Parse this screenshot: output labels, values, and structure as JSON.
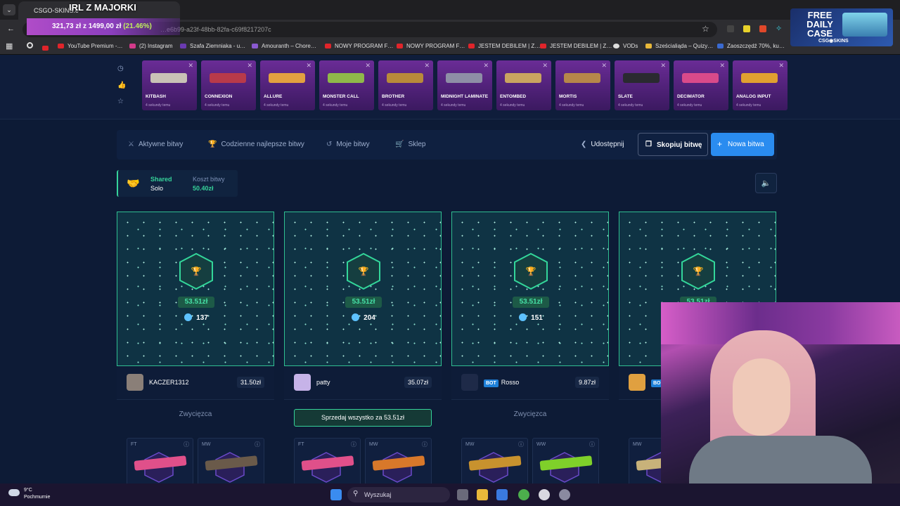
{
  "browser": {
    "tab_title": "CSGO-SKINS.c",
    "url": "…e6b99-a23f-48bb-82fa-c69f8217207c",
    "bookmarks": [
      {
        "label": "YouTube Premium -…"
      },
      {
        "label": "(2) Instagram"
      },
      {
        "label": "Szafa Ziemniaka - u…"
      },
      {
        "label": "Amouranth – Chore…"
      },
      {
        "label": "NOWY PROGRAM F…"
      },
      {
        "label": "NOWY PROGRAM F…"
      },
      {
        "label": "JESTEM DEBILEM | Z…"
      },
      {
        "label": "JESTEM DEBILEM | Z…"
      },
      {
        "label": "VODs"
      },
      {
        "label": "Sześcialiąda – Quizy…"
      },
      {
        "label": "Zaoszczędź 70%, ku…"
      }
    ]
  },
  "stream_overlay": {
    "title": "IRL Z MAJORKI",
    "goal_current": "321,73 zł",
    "goal_sep": "z",
    "goal_total": "1499,00 zł",
    "goal_pct": "(21.46%)",
    "promo_title": "FREE DAILY CASE",
    "promo_brand": "CSG◉SKINS"
  },
  "recent_drops": [
    {
      "name": "KITBASH",
      "time": "4 sekundy temu",
      "color": "#c9c2b6"
    },
    {
      "name": "CONNEXION",
      "time": "4 sekundy temu",
      "color": "#b83a4a"
    },
    {
      "name": "ALLURE",
      "time": "4 sekundy temu",
      "color": "#e2a040"
    },
    {
      "name": "MONSTER CALL",
      "time": "4 sekundy temu",
      "color": "#8fb84a"
    },
    {
      "name": "BROTHER",
      "time": "4 sekundy temu",
      "color": "#b88a3a"
    },
    {
      "name": "MIDNIGHT LAMINATE",
      "time": "4 sekundy temu",
      "color": "#8e8ea6"
    },
    {
      "name": "ENTOMBED",
      "time": "4 sekundy temu",
      "color": "#c9a460"
    },
    {
      "name": "MORTIS",
      "time": "4 sekundy temu",
      "color": "#b6874a"
    },
    {
      "name": "SLATE",
      "time": "4 sekundy temu",
      "color": "#2a2a30"
    },
    {
      "name": "DECIMATOR",
      "time": "4 sekundy temu",
      "color": "#d94a8a"
    },
    {
      "name": "ANALOG INPUT",
      "time": "4 sekundy temu",
      "color": "#e0a030"
    }
  ],
  "nav": {
    "active": "Aktywne bitwy",
    "daily": "Codzienne najlepsze bitwy",
    "mine": "Moje bitwy",
    "shop": "Sklep",
    "share": "Udostępnij",
    "copy": "Skopiuj bitwę",
    "new": "Nowa bitwa"
  },
  "battle": {
    "mode_label": "Shared",
    "mode_value": "Solo",
    "cost_label": "Koszt bitwy",
    "cost_value": "50.40zł"
  },
  "players": [
    {
      "prize": "53.51zł",
      "coins": "137",
      "name": "KACZER1312",
      "value": "31.50zł",
      "bot": false,
      "status": "Zwycięzca",
      "items": [
        {
          "wear": "FT",
          "color": "#e0508a"
        },
        {
          "wear": "MW",
          "color": "#6a5a4a"
        }
      ]
    },
    {
      "prize": "53.51zł",
      "coins": "204",
      "name": "patty",
      "value": "35.07zł",
      "bot": false,
      "status": "Sprzedaj wszystko za 53.51zł",
      "items": [
        {
          "wear": "FT",
          "color": "#e0508a"
        },
        {
          "wear": "MW",
          "color": "#d8782a"
        }
      ]
    },
    {
      "prize": "53.51zł",
      "coins": "151",
      "name": "Rosso",
      "value": "9.87zł",
      "bot": true,
      "bot_label": "BOT",
      "status": "Zwycięzca",
      "items": [
        {
          "wear": "MW",
          "color": "#c8922e"
        },
        {
          "wear": "WW",
          "color": "#7fd02a"
        }
      ]
    },
    {
      "prize": "53.51zł",
      "coins": "",
      "name": "",
      "value": "",
      "bot": true,
      "bot_label": "BO",
      "status": "",
      "items": [
        {
          "wear": "MW",
          "color": "#c8b27a"
        }
      ]
    }
  ],
  "taskbar": {
    "temp": "9°C",
    "weather": "Pochmurnie",
    "search": "Wyszukaj"
  }
}
